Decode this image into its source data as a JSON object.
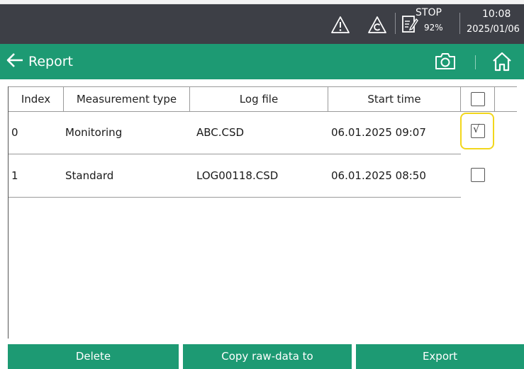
{
  "status": {
    "warning_icon": "warning-triangle-icon",
    "calibration_icon": "calibration-warning-icon",
    "log_icon": "log-edit-icon",
    "log_state": "STOP",
    "battery": "92%",
    "time": "10:08",
    "date": "2025/01/06"
  },
  "header": {
    "title": "Report",
    "back_icon": "back-arrow-icon",
    "camera_icon": "camera-icon",
    "home_icon": "home-icon"
  },
  "table": {
    "columns": [
      "Index",
      "Measurement type",
      "Log file",
      "Start time"
    ],
    "rows": [
      {
        "index": "0",
        "type": "Monitoring",
        "log_file": "ABC.CSD",
        "start_time": "06.01.2025 09:07",
        "checked": true
      },
      {
        "index": "1",
        "type": "Standard",
        "log_file": "LOG00118.CSD",
        "start_time": "06.01.2025 08:50",
        "checked": false
      }
    ],
    "select_all_checked": false
  },
  "footer": {
    "delete_label": "Delete",
    "copy_label": "Copy raw-data to",
    "export_label": "Export"
  },
  "colors": {
    "status_bar": "#3d3f46",
    "accent_green": "#1d9a73",
    "highlight_yellow": "#f2d71c"
  }
}
